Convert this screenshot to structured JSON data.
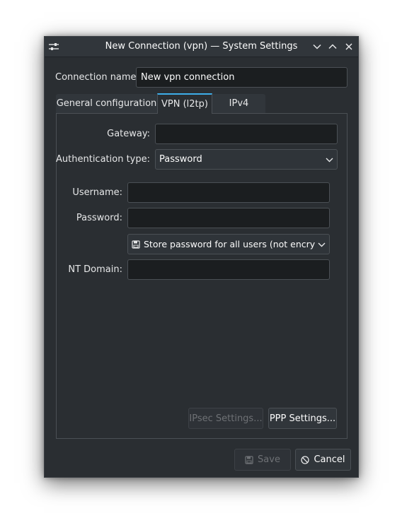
{
  "window": {
    "title": "New Connection (vpn) — System Settings"
  },
  "connection": {
    "name_label": "Connection name:",
    "name_value": "New vpn connection"
  },
  "tabs": [
    {
      "label": "General configuration",
      "active": false
    },
    {
      "label": "VPN (l2tp)",
      "active": true
    },
    {
      "label": "IPv4",
      "active": false
    }
  ],
  "vpn": {
    "gateway_label": "Gateway:",
    "gateway_value": "",
    "auth_label": "Authentication type:",
    "auth_value": "Password",
    "username_label": "Username:",
    "username_value": "",
    "password_label": "Password:",
    "password_value": "",
    "store_password_value": "Store password for all users (not encrypted)",
    "nt_domain_label": "NT Domain:",
    "nt_domain_value": ""
  },
  "buttons": {
    "ipsec": "IPsec Settings...",
    "ppp": "PPP Settings...",
    "save": "Save",
    "cancel": "Cancel"
  },
  "icons": {
    "app": "settings-sliders-icon",
    "minimize": "chevron-down-icon",
    "maximize": "chevron-up-icon",
    "close": "close-icon",
    "store": "floppy-disk-icon",
    "save": "floppy-disk-icon",
    "cancel": "cancel-circle-icon"
  },
  "colors": {
    "background": "#2a2e32",
    "titlebar": "#31363b",
    "accent": "#3daee9",
    "input_bg": "#1b1e20",
    "border": "#4b5055",
    "text": "#e6e7e8",
    "disabled_text": "#6e7175"
  }
}
